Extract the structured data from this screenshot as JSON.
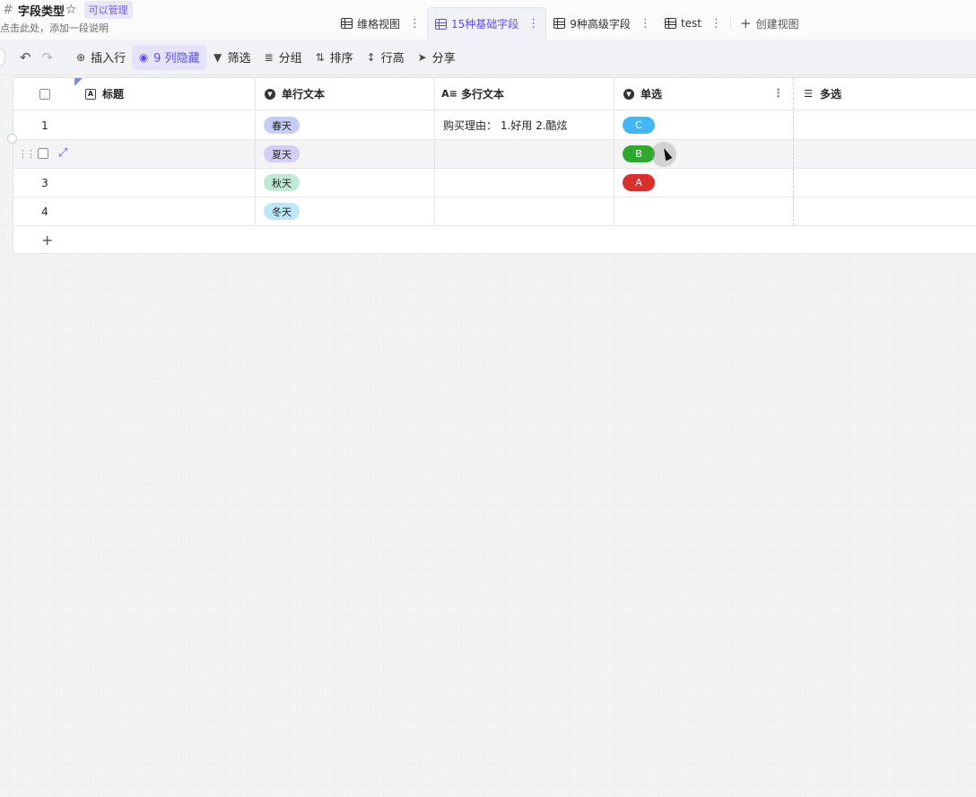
{
  "doc": {
    "title": "字段类型",
    "permission": "可以管理",
    "description": "点击此处，添加一段说明"
  },
  "tabs": [
    {
      "label": "维格视图",
      "active": false
    },
    {
      "label": "15种基础字段",
      "active": true
    },
    {
      "label": "9种高级字段",
      "active": false
    },
    {
      "label": "test",
      "active": false
    }
  ],
  "create_view_label": "创建视图",
  "toolbar": {
    "insert_row": "插入行",
    "hidden_columns": "9 列隐藏",
    "filter": "筛选",
    "group": "分组",
    "sort": "排序",
    "row_height": "行高",
    "share": "分享"
  },
  "columns": {
    "title": "标题",
    "single_text": "单行文本",
    "multi_text": "多行文本",
    "single_select": "单选",
    "multi_select": "多选"
  },
  "rows": [
    {
      "num": "1",
      "title": "",
      "single_text": "春天",
      "multi_text": "购买理由： 1.好用 2.酷炫",
      "select": "C"
    },
    {
      "num": "2",
      "title": "",
      "single_text": "夏天",
      "multi_text": "",
      "select": "B"
    },
    {
      "num": "3",
      "title": "",
      "single_text": "秋天",
      "multi_text": "",
      "select": "A"
    },
    {
      "num": "4",
      "title": "",
      "single_text": "冬天",
      "multi_text": "",
      "select": ""
    }
  ],
  "colors": {
    "accent": "#5b4fe0",
    "tag_spring": "#c5cdf5",
    "tag_summer": "#d6cdf4",
    "tag_autumn": "#bfe8d5",
    "tag_winter": "#bfe6f5",
    "opt_c": "#45b6f5",
    "opt_b": "#2ea82e",
    "opt_a": "#d9302c"
  }
}
